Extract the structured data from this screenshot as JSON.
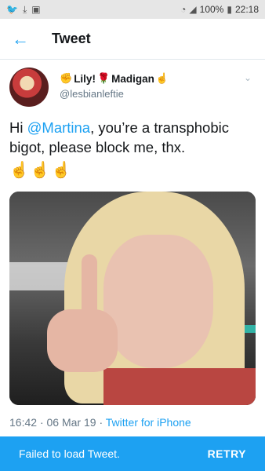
{
  "status_bar": {
    "battery": "100%",
    "time": "22:18",
    "left_icons": [
      "twitter-notification-icon",
      "download-icon",
      "sim-icon"
    ],
    "right_icons": [
      "wifi-icon",
      "signal-icon",
      "battery-icon"
    ]
  },
  "app_bar": {
    "title": "Tweet"
  },
  "tweet": {
    "display_name": "Lily!",
    "display_name_2": "Madigan",
    "handle": "@lesbianleftie",
    "text_prefix": "Hi ",
    "mention": "@Martina",
    "text_suffix": ", you’re a transphobic bigot, please block me, thx.",
    "emojis": "☝☝☝",
    "time": "16:42",
    "date": "06 Mar 19",
    "source": "Twitter for iPhone"
  },
  "snackbar": {
    "message": "Failed to load Tweet.",
    "action": "RETRY"
  },
  "colors": {
    "accent": "#1da1f2",
    "text": "#14171a",
    "muted": "#657786"
  }
}
